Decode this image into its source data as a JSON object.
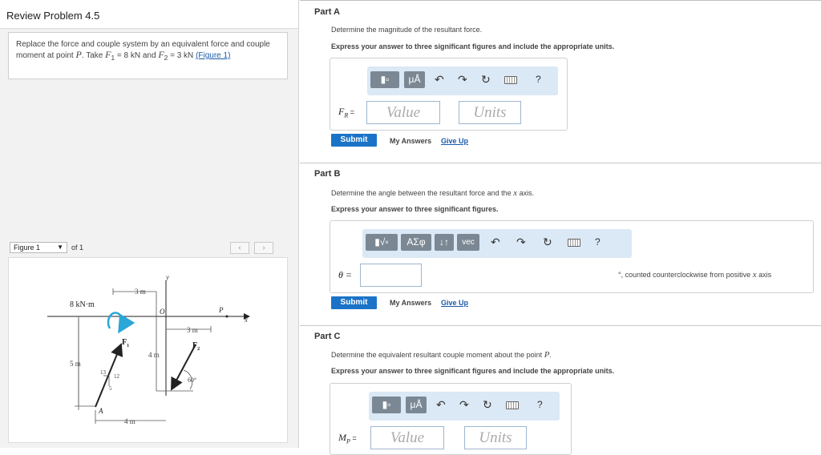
{
  "left_panel": {
    "title": "Review Problem 4.5",
    "problem": {
      "text_1": "Replace the force and couple system by an equivalent force and couple moment at point",
      "point": "P",
      "text_2": ". Take",
      "f1": "F",
      "f1_sub": "1",
      "f1_val": " = 8 kN",
      "and": " and ",
      "f2": "F",
      "f2_sub": "2",
      "f2_val": " = 3 kN",
      "link": "(Figure 1)"
    },
    "figure_nav": {
      "selected": "Figure 1",
      "of": "of 1",
      "prev_icon": "chevron-left-icon",
      "next_icon": "chevron-right-icon"
    },
    "figure": {
      "moment_label": "8 kN·m",
      "dim_3m_top": "3 m",
      "dim_3m_right": "3 m",
      "dim_4m_vert": "4 m",
      "dim_5m": "5 m",
      "dim_4m_bottom": "4 m",
      "axis_y": "y",
      "axis_x": "x",
      "origin": "O",
      "point_p": "P",
      "point_a": "A",
      "f1_label": "F",
      "f1_sub": "1",
      "f2_label": "F",
      "f2_sub": "2",
      "tri_13": "13",
      "tri_12": "12",
      "tri_5": "5",
      "angle": "60°",
      "colors": {
        "moment_arrow": "#2aa6d9"
      }
    }
  },
  "parts": [
    {
      "title": "Part A",
      "prompt": "Determine the magnitude of the resultant force.",
      "instruction": "Express your answer to three significant figures and include the appropriate units.",
      "toolbar": {
        "templates_icon": "templates-icon",
        "units_label": "μÅ",
        "undo_icon": "undo-icon",
        "redo_icon": "redo-icon",
        "reset_icon": "reset-icon",
        "keyboard_icon": "keyboard-icon",
        "help_label": "?"
      },
      "field_label": "F",
      "field_sub": "R",
      "field_eq": " =",
      "value_placeholder": "Value",
      "units_placeholder": "Units",
      "submit": "Submit",
      "my_answers": "My Answers",
      "give_up": "Give Up"
    },
    {
      "title": "Part B",
      "prompt_1": "Determine the angle between the resultant force and the",
      "prompt_x": "x",
      "prompt_2": "axis.",
      "instruction": "Express your answer to three significant figures.",
      "toolbar": {
        "templates_icon": "sqrt-templates-icon",
        "greek_label": "ΑΣφ",
        "arrows_label": "↓↑",
        "vec_label": "vec",
        "undo_icon": "undo-icon",
        "redo_icon": "redo-icon",
        "reset_icon": "reset-icon",
        "keyboard_icon": "keyboard-icon",
        "help_label": "?"
      },
      "field_label": "θ =",
      "unit_note_1": "°, counted counterclockwise from positive",
      "unit_note_x": "x",
      "unit_note_2": "axis",
      "submit": "Submit",
      "my_answers": "My Answers",
      "give_up": "Give Up"
    },
    {
      "title": "Part C",
      "prompt_1": "Determine the equivalent resultant couple moment about the point",
      "prompt_p": "P",
      "prompt_2": ".",
      "instruction": "Express your answer to three significant figures and include the appropriate units.",
      "toolbar": {
        "templates_icon": "templates-icon",
        "units_label": "μÅ",
        "undo_icon": "undo-icon",
        "redo_icon": "redo-icon",
        "reset_icon": "reset-icon",
        "keyboard_icon": "keyboard-icon",
        "help_label": "?"
      },
      "field_label": "M",
      "field_sub": "P",
      "field_eq": " =",
      "value_placeholder": "Value",
      "units_placeholder": "Units"
    }
  ],
  "colors": {
    "submit": "#1a73c7",
    "toolbar_bg": "#dbe8f5",
    "link": "#1a5aa8"
  }
}
